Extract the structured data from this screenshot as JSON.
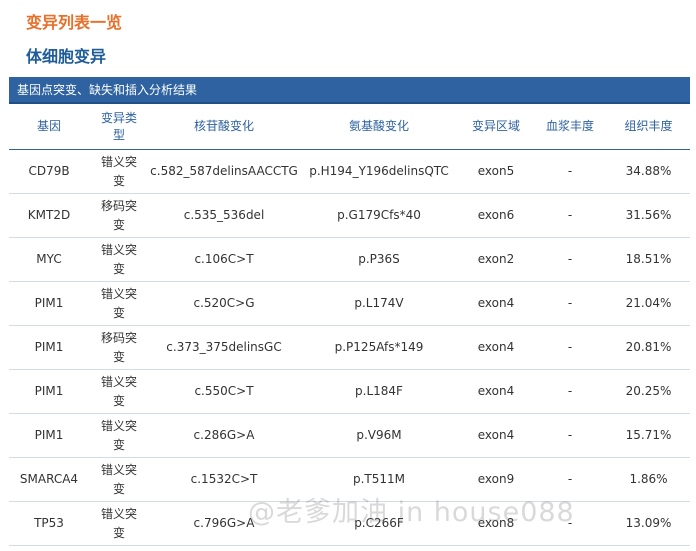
{
  "page_title": "变异列表一览",
  "section_title": "体细胞变异",
  "table": {
    "caption": "基因点突变、缺失和插入分析结果",
    "headers": [
      "基因",
      "变异类型",
      "核苷酸变化",
      "氨基酸变化",
      "变异区域",
      "血浆丰度",
      "组织丰度"
    ],
    "rows": [
      [
        "CD79B",
        "错义突变",
        "c.582_587delinsAACCTG",
        "p.H194_Y196delinsQTC",
        "exon5",
        "-",
        "34.88%"
      ],
      [
        "KMT2D",
        "移码突变",
        "c.535_536del",
        "p.G179Cfs*40",
        "exon6",
        "-",
        "31.56%"
      ],
      [
        "MYC",
        "错义突变",
        "c.106C>T",
        "p.P36S",
        "exon2",
        "-",
        "18.51%"
      ],
      [
        "PIM1",
        "错义突变",
        "c.520C>G",
        "p.L174V",
        "exon4",
        "-",
        "21.04%"
      ],
      [
        "PIM1",
        "移码突变",
        "c.373_375delinsGC",
        "p.P125Afs*149",
        "exon4",
        "-",
        "20.81%"
      ],
      [
        "PIM1",
        "错义突变",
        "c.550C>T",
        "p.L184F",
        "exon4",
        "-",
        "20.25%"
      ],
      [
        "PIM1",
        "错义突变",
        "c.286G>A",
        "p.V96M",
        "exon4",
        "-",
        "15.71%"
      ],
      [
        "SMARCA4",
        "错义突变",
        "c.1532C>T",
        "p.T511M",
        "exon9",
        "-",
        "1.86%"
      ],
      [
        "TP53",
        "错义突变",
        "c.796G>A",
        "p.C266F",
        "exon8",
        "-",
        "13.09%"
      ]
    ]
  },
  "watermark": "@老爹加油 in house088"
}
